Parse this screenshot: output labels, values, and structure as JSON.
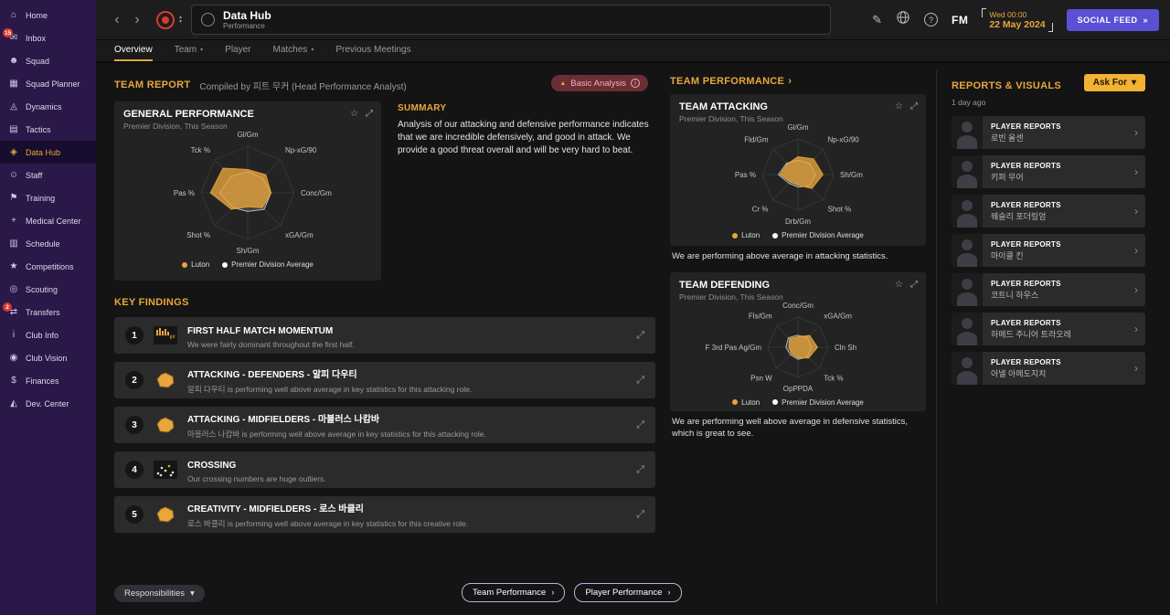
{
  "colors": {
    "accent": "#e9a63c",
    "panel": "#232323",
    "row": "#2b2b2b",
    "bg": "#141414",
    "topbar": "#1d1d1d",
    "sidebar": "#2a1848",
    "sidebar_active": "#170d2e",
    "social": "#5a50d5",
    "record": "#d93a2e",
    "badge": "#d6392f",
    "askfor": "#f2b233",
    "pill_bg": "#6b2e35",
    "pill_text": "#efb3b6",
    "team_color": "#e9a63c",
    "avg_color": "#c8c8c8"
  },
  "topbar": {
    "title": "Data Hub",
    "subtitle": "Performance",
    "fm_logo": "FM",
    "date_time": "Wed 00:00",
    "date_day": "22 May 2024",
    "social_feed_label": "SOCIAL FEED"
  },
  "icons": {
    "back": "‹",
    "forward": "›",
    "caret_up": "▴",
    "caret_down": "▾",
    "star": "☆",
    "expand": "⤢",
    "chevron_right": "›",
    "double_chevron": "»",
    "edit": "✎",
    "help": "?",
    "info": "i",
    "analysis_flag": "▲"
  },
  "sidebar": {
    "items": [
      {
        "label": "Home",
        "glyph": "⌂"
      },
      {
        "label": "Inbox",
        "glyph": "✉",
        "badge": "15"
      },
      {
        "label": "Squad",
        "glyph": "☻"
      },
      {
        "label": "Squad Planner",
        "glyph": "▦"
      },
      {
        "label": "Dynamics",
        "glyph": "◬"
      },
      {
        "label": "Tactics",
        "glyph": "▤"
      },
      {
        "label": "Data Hub",
        "glyph": "◈"
      },
      {
        "label": "Staff",
        "glyph": "☺"
      },
      {
        "label": "Training",
        "glyph": "⚑"
      },
      {
        "label": "Medical Center",
        "glyph": "+"
      },
      {
        "label": "Schedule",
        "glyph": "▥"
      },
      {
        "label": "Competitions",
        "glyph": "★"
      },
      {
        "label": "Scouting",
        "glyph": "◎"
      },
      {
        "label": "Transfers",
        "glyph": "⇄",
        "badge": "2"
      },
      {
        "label": "Club Info",
        "glyph": "i"
      },
      {
        "label": "Club Vision",
        "glyph": "◉"
      },
      {
        "label": "Finances",
        "glyph": "$"
      },
      {
        "label": "Dev. Center",
        "glyph": "◭"
      }
    ]
  },
  "tabs": {
    "items": [
      {
        "label": "Overview"
      },
      {
        "label": "Team"
      },
      {
        "label": "Player"
      },
      {
        "label": "Matches"
      },
      {
        "label": "Previous Meetings"
      }
    ]
  },
  "report": {
    "title": "TEAM REPORT",
    "compiled_by": "Compiled by 피트 무커 (Head Performance Analyst)",
    "analysis_level": "Basic Analysis",
    "summary_title": "SUMMARY",
    "summary_text": "Analysis of our attacking and defensive performance indicates that we are incredible defensively, and good in attack. We provide a good threat overall and will be very hard to beat."
  },
  "general_panel": {
    "title": "GENERAL PERFORMANCE",
    "subtitle": "Premier Division, This Season"
  },
  "legend": {
    "team": "Luton",
    "avg": "Premier Division Average"
  },
  "key_findings": {
    "title": "KEY FINDINGS",
    "items": [
      {
        "num": "1",
        "icon": "momentum",
        "title": "FIRST HALF MATCH MOMENTUM",
        "desc": "We were fairly dominant throughout the first half."
      },
      {
        "num": "2",
        "icon": "polygon",
        "title": "ATTACKING - DEFENDERS - 알피 다우티",
        "desc": "알피 다우티 is performing well above average in key statistics for this attacking role."
      },
      {
        "num": "3",
        "icon": "polygon",
        "title": "ATTACKING - MIDFIELDERS - 마블러스 나캄바",
        "desc": "마블러스 나캄바 is performing well above average in key statistics for this attacking role."
      },
      {
        "num": "4",
        "icon": "scatter",
        "title": "CROSSING",
        "desc": "Our crossing numbers are huge outliers."
      },
      {
        "num": "5",
        "icon": "polygon",
        "title": "CREATIVITY - MIDFIELDERS - 로스 바클리",
        "desc": "로스 바클리 is performing well above average in key statistics for this creative role."
      }
    ]
  },
  "team_performance": {
    "header": "TEAM PERFORMANCE",
    "attacking": {
      "title": "TEAM ATTACKING",
      "subtitle": "Premier Division, This Season",
      "caption": "We are performing above average in attacking statistics."
    },
    "defending": {
      "title": "TEAM DEFENDING",
      "subtitle": "Premier Division, This Season",
      "caption": "We are performing well above average in defensive statistics, which is great to see."
    }
  },
  "reports_visuals": {
    "title": "REPORTS & VISUALS",
    "ago": "1 day ago",
    "ask_for": "Ask For",
    "items": [
      {
        "label": "PLAYER REPORTS",
        "name": "로빈 올센"
      },
      {
        "label": "PLAYER REPORTS",
        "name": "키퍼 무어"
      },
      {
        "label": "PLAYER REPORTS",
        "name": "웨슬리 포더링엄"
      },
      {
        "label": "PLAYER REPORTS",
        "name": "마이클 킨"
      },
      {
        "label": "PLAYER REPORTS",
        "name": "코트니 하우스"
      },
      {
        "label": "PLAYER REPORTS",
        "name": "하메드 주니어 트라오레"
      },
      {
        "label": "PLAYER REPORTS",
        "name": "아넬 아메도지치"
      }
    ]
  },
  "footer": {
    "responsibilities": "Responsibilities",
    "team_performance": "Team Performance",
    "player_performance": "Player Performance"
  },
  "chart_data": [
    {
      "type": "radar",
      "title": "General Performance",
      "axes": [
        "Gl/Gm",
        "Np-xG/90",
        "Conc/Gm",
        "xGA/Gm",
        "Sh/Gm",
        "Shot %",
        "Pas %",
        "Tck %"
      ],
      "series": [
        {
          "name": "Premier Division Average",
          "color": "#c8c8c8",
          "fill_opacity": 0.18,
          "values": [
            0.45,
            0.45,
            0.5,
            0.5,
            0.4,
            0.45,
            0.6,
            0.5
          ]
        },
        {
          "name": "Luton",
          "color": "#e9a63c",
          "fill_opacity": 0.78,
          "values": [
            0.5,
            0.55,
            0.5,
            0.45,
            0.3,
            0.5,
            0.8,
            0.75
          ]
        }
      ]
    },
    {
      "type": "radar",
      "title": "Team Attacking",
      "axes": [
        "Gl/Gm",
        "Np-xG/90",
        "Sh/Gm",
        "Shot %",
        "Drb/Gm",
        "Cr %",
        "Pas %",
        "Fld/Gm"
      ],
      "series": [
        {
          "name": "Premier Division Average",
          "color": "#c8c8c8",
          "fill_opacity": 0.18,
          "values": [
            0.4,
            0.45,
            0.5,
            0.45,
            0.35,
            0.35,
            0.55,
            0.45
          ]
        },
        {
          "name": "Luton",
          "color": "#e9a63c",
          "fill_opacity": 0.78,
          "values": [
            0.5,
            0.62,
            0.7,
            0.55,
            0.3,
            0.3,
            0.5,
            0.42
          ]
        }
      ]
    },
    {
      "type": "radar",
      "title": "Team Defending",
      "axes": [
        "Conc/Gm",
        "xGA/Gm",
        "Cln Sh",
        "Tck %",
        "OpPPDA",
        "Psn W",
        "F 3rd Pas Ag/Gm",
        "Fls/Gm"
      ],
      "series": [
        {
          "name": "Premier Division Average",
          "color": "#c8c8c8",
          "fill_opacity": 0.18,
          "values": [
            0.4,
            0.45,
            0.45,
            0.45,
            0.4,
            0.35,
            0.4,
            0.45
          ]
        },
        {
          "name": "Luton",
          "color": "#e9a63c",
          "fill_opacity": 0.78,
          "values": [
            0.35,
            0.55,
            0.65,
            0.5,
            0.35,
            0.3,
            0.3,
            0.4
          ]
        }
      ]
    }
  ]
}
